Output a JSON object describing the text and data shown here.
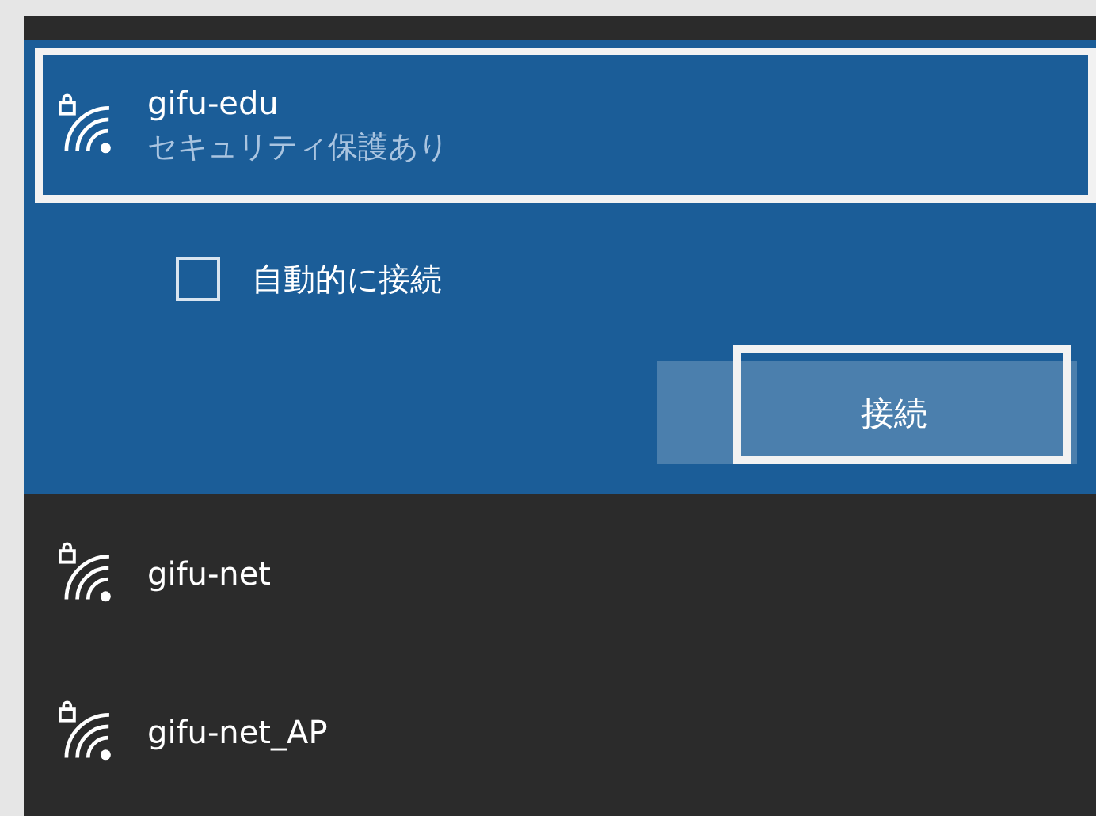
{
  "networks": [
    {
      "name": "gifu-edu",
      "secured": true,
      "selected": true,
      "highlighted": true,
      "status": "セキュリティ保護あり",
      "auto_connect": {
        "label": "自動的に接続",
        "checked": false
      },
      "connect_button": {
        "label": "接続",
        "highlighted": true
      }
    },
    {
      "name": "gifu-net",
      "secured": true,
      "selected": false,
      "highlighted": false
    },
    {
      "name": "gifu-net_AP",
      "secured": true,
      "selected": false,
      "highlighted": false
    }
  ]
}
